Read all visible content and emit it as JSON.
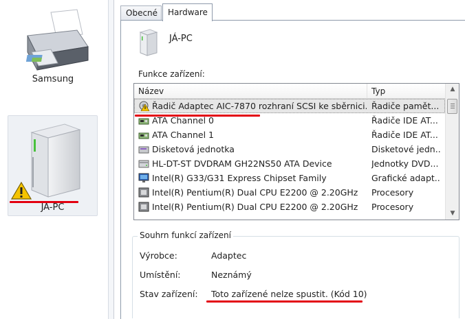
{
  "devices": {
    "printer": {
      "label": "Samsung",
      "icon": "printer-icon"
    },
    "computer": {
      "label": "JÁ-PC",
      "icon": "external-drive-icon",
      "badge": "warning-icon"
    }
  },
  "tabs": [
    {
      "label": "Obecné",
      "active": false
    },
    {
      "label": "Hardware",
      "active": true
    }
  ],
  "hardware": {
    "device_name": "JÁ-PC",
    "functions_label": "Funkce zařízení:",
    "columns": {
      "name": "Název",
      "type": "Typ"
    },
    "rows": [
      {
        "name": "Řadič Adaptec AIC-7870 rozhraní SCSI ke sběrnici...",
        "type": "Řadiče pamět...",
        "icon": "warning-device-icon",
        "selected": true
      },
      {
        "name": "ATA Channel 0",
        "type": "Řadiče IDE AT...",
        "icon": "ide-controller-icon"
      },
      {
        "name": "ATA Channel 1",
        "type": "Řadiče IDE AT...",
        "icon": "ide-controller-icon"
      },
      {
        "name": "Disketová jednotka",
        "type": "Disketové jedn...",
        "icon": "floppy-drive-icon"
      },
      {
        "name": "HL-DT-ST DVDRAM GH22NS50 ATA Device",
        "type": "Jednotky DVD...",
        "icon": "dvd-drive-icon"
      },
      {
        "name": "Intel(R) G33/G31 Express Chipset Family",
        "type": "Grafické adapt...",
        "icon": "display-adapter-icon"
      },
      {
        "name": "Intel(R) Pentium(R) Dual  CPU  E2200  @ 2.20GHz",
        "type": "Procesory",
        "icon": "processor-icon"
      },
      {
        "name": "Intel(R) Pentium(R) Dual  CPU  E2200  @ 2.20GHz",
        "type": "Procesory",
        "icon": "processor-icon"
      }
    ]
  },
  "summary": {
    "title": "Souhrn funkcí zařízení",
    "manufacturer_label": "Výrobce:",
    "manufacturer": "Adaptec",
    "location_label": "Umístění:",
    "location": "Neznámý",
    "status_label": "Stav zařízení:",
    "status": "Toto zařízené nelze spustit. (Kód 10)"
  },
  "colors": {
    "highlight_underline": "#e3000f",
    "warning_yellow": "#f5c400",
    "selection": "#e6e6e6"
  }
}
